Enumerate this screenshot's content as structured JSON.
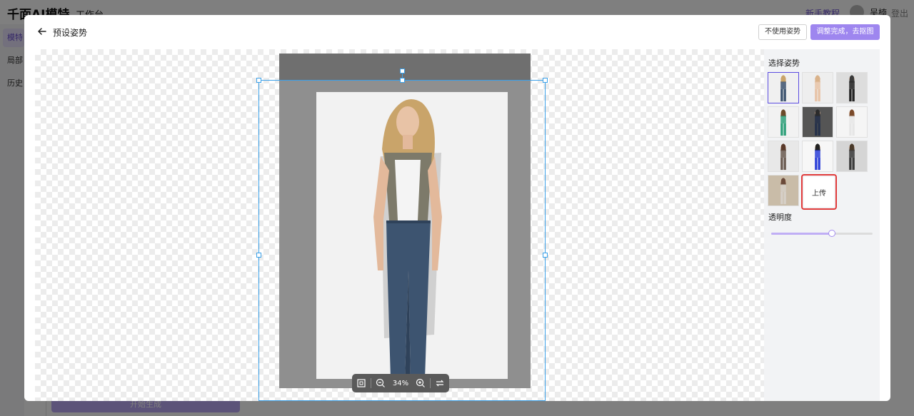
{
  "app": {
    "brand": "千面AI模特",
    "subtitle": "工作台",
    "tutorial_link": "新手教程",
    "user_name": "吴楠",
    "logout": "登出",
    "nav": [
      "模特",
      "局部",
      "历史"
    ],
    "generate_button": "开始生成"
  },
  "modal": {
    "title": "预设姿势",
    "btn_no_pose": "不使用姿势",
    "btn_done": "调整完成，去抠图"
  },
  "toolbar": {
    "zoom_level": "34%",
    "icons": [
      "fit-icon",
      "zoom-out-icon",
      "zoom-in-icon",
      "swap-icon"
    ]
  },
  "panel": {
    "select_pose_label": "选择姿势",
    "upload_label": "上传",
    "opacity_label": "透明度",
    "opacity_value": 0.6,
    "selected_pose_index": 0,
    "pose_count": 10
  },
  "colors": {
    "accent": "#9e86ef",
    "selection": "#3aa0e8",
    "highlight_red": "#e03b3b"
  }
}
